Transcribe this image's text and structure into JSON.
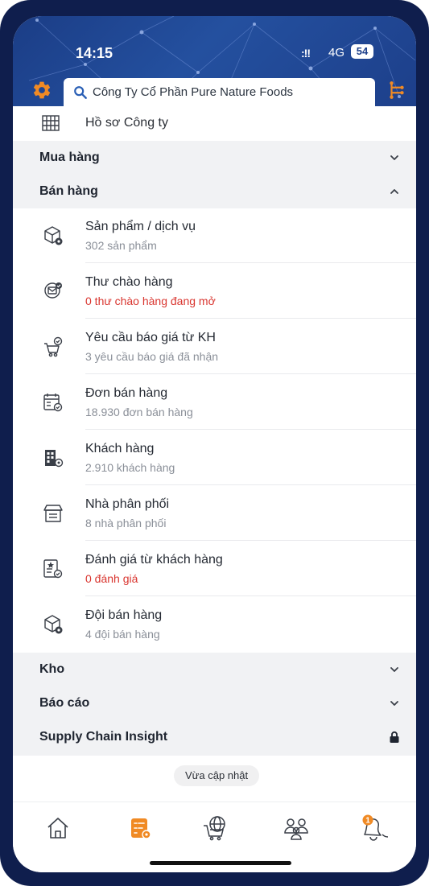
{
  "status_bar": {
    "time": "14:15",
    "signal": ":!!",
    "network": "4G",
    "battery": "54"
  },
  "header": {
    "search_text": "Công Ty Cổ Phần Pure Nature Foods",
    "settings_icon": "gear-icon",
    "tree_icon": "org-tree-icon",
    "accent_color": "#f08a24"
  },
  "company_profile": {
    "label": "Hồ sơ Công ty",
    "icon": "building-grid-icon"
  },
  "sections": {
    "purchase": {
      "title": "Mua hàng",
      "expanded": false
    },
    "sales": {
      "title": "Bán hàng",
      "expanded": true
    },
    "warehouse": {
      "title": "Kho",
      "expanded": false
    },
    "reports": {
      "title": "Báo cáo",
      "expanded": false
    },
    "supply": {
      "title": "Supply Chain Insight",
      "locked": true
    }
  },
  "sales_items": [
    {
      "title": "Sản phẩm / dịch vụ",
      "subtitle": "302 sản phẩm",
      "highlight": false,
      "icon": "product-box-icon"
    },
    {
      "title": "Thư chào hàng",
      "subtitle": "0 thư chào hàng đang mở",
      "highlight": true,
      "icon": "offer-letter-icon"
    },
    {
      "title": "Yêu cầu báo giá từ KH",
      "subtitle": "3 yêu cầu báo giá đã nhận",
      "highlight": false,
      "icon": "cart-check-icon"
    },
    {
      "title": "Đơn bán hàng",
      "subtitle": "18.930 đơn bán hàng",
      "highlight": false,
      "icon": "sales-order-icon"
    },
    {
      "title": "Khách hàng",
      "subtitle": "2.910 khách hàng",
      "highlight": false,
      "icon": "customer-building-icon"
    },
    {
      "title": "Nhà phân phối",
      "subtitle": "8 nhà phân phối",
      "highlight": false,
      "icon": "distributor-store-icon"
    },
    {
      "title": "Đánh giá từ khách hàng",
      "subtitle": "0 đánh giá",
      "highlight": true,
      "icon": "review-check-icon"
    },
    {
      "title": "Đội bán hàng",
      "subtitle": "4 đội bán hàng",
      "highlight": false,
      "icon": "sales-team-icon"
    }
  ],
  "update_label": "Vừa cập nhật",
  "bottom_nav": [
    {
      "icon": "home-icon",
      "active": false
    },
    {
      "icon": "task-list-icon",
      "active": true
    },
    {
      "icon": "global-cart-icon",
      "active": false
    },
    {
      "icon": "people-icon",
      "active": false
    },
    {
      "icon": "notification-bell-icon",
      "active": false,
      "badge": "1"
    }
  ]
}
